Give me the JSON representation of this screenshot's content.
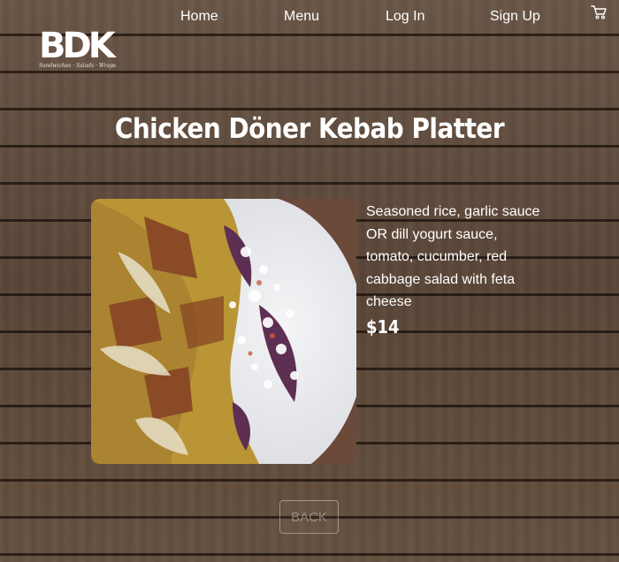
{
  "nav": {
    "home": "Home",
    "menu": "Menu",
    "login": "Log In",
    "signup": "Sign Up",
    "cart_icon": "shopping-cart-icon"
  },
  "brand": {
    "logo": "BDK",
    "tagline": "Sandwiches · Salads · Wraps"
  },
  "item": {
    "title": "Chicken Döner Kebab Platter",
    "description": "Seasoned rice, garlic sauce OR dill yogurt sauce, tomato, cucumber, red cabbage salad with feta cheese",
    "price": "$14"
  },
  "actions": {
    "back": "BACK"
  }
}
